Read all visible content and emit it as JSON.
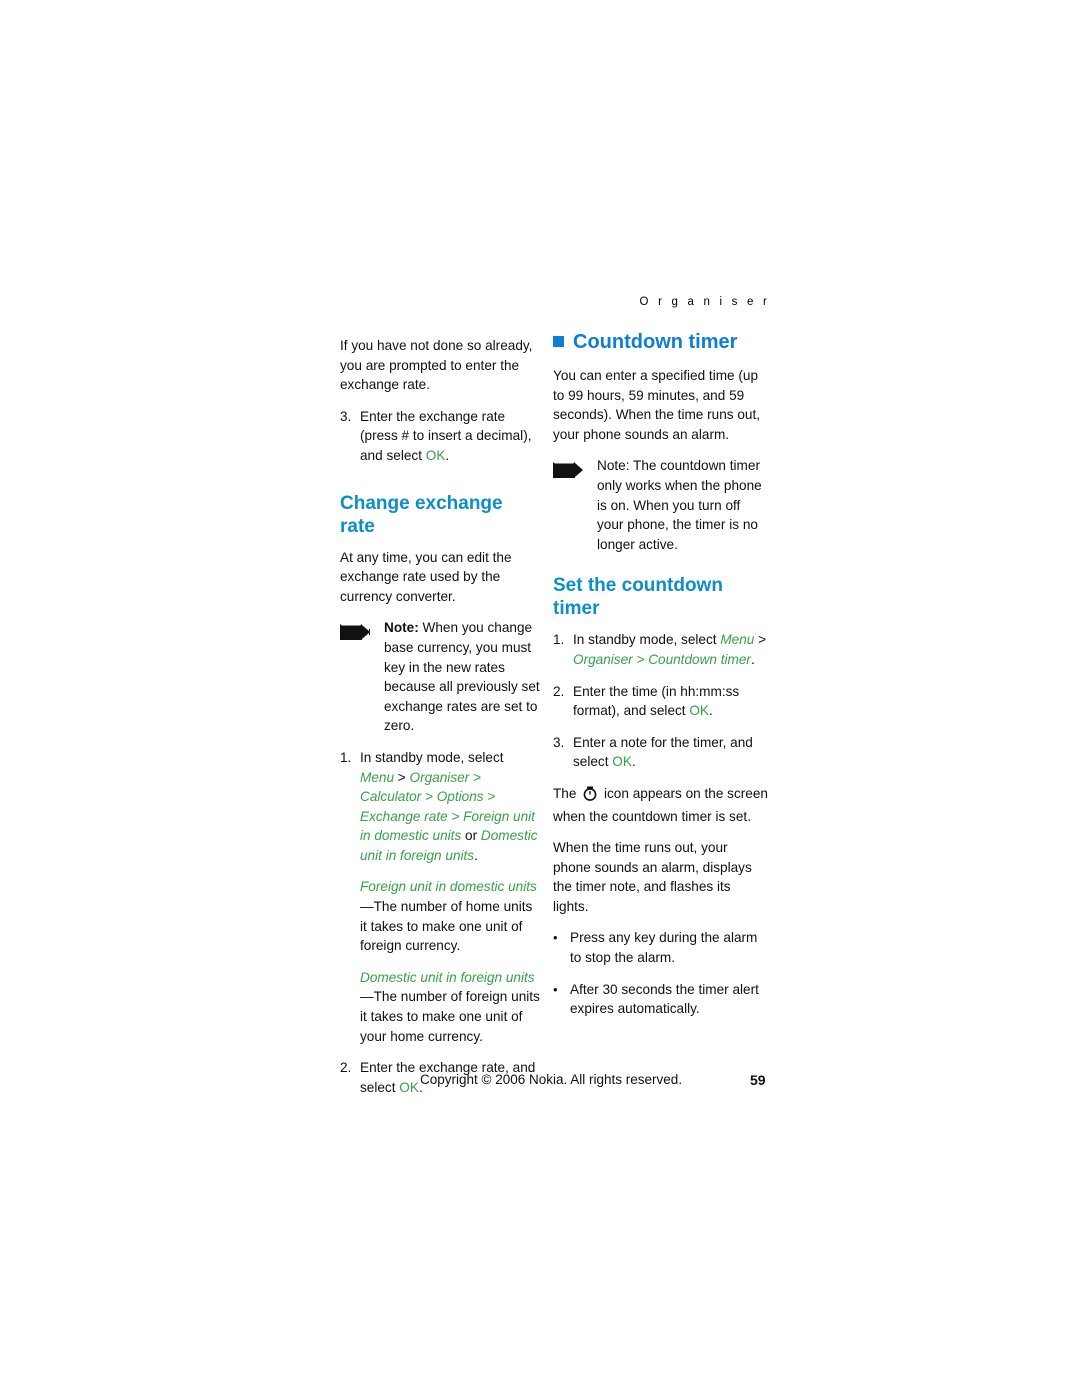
{
  "header": {
    "running_head": "O r g a n i s e r"
  },
  "left_column": {
    "para1": "If you have not done so already, you are prompted to enter the exchange rate.",
    "step3_num": "3.",
    "step3_pre": "Enter the exchange rate (press ",
    "step3_hash": "#",
    "step3_mid": " to insert a decimal), and select ",
    "step3_ok": "OK",
    "step3_end": ".",
    "heading_change_exchange_rate": "Change exchange rate",
    "para2": "At any time, you can edit the exchange rate used by the currency converter.",
    "note1_label": "Note:",
    "note1_text": " When you change base currency, you must key in the new rates because all previously set exchange rates are set to zero.",
    "step1_num": "1.",
    "step1_pre": "In standby mode, select ",
    "step1_menu": "Menu",
    "step1_gt1": " > ",
    "step1_organiser": "Organiser",
    "step1_gt2": " > ",
    "step1_calculator": "Calculator",
    "step1_gt3": " > ",
    "step1_options": "Options",
    "step1_gt4": " > ",
    "step1_exchange": "Exchange rate",
    "step1_gt5": " > ",
    "step1_foreign": "Foreign unit in domestic units",
    "step1_or": " or ",
    "step1_domestic": "Domestic unit in foreign units",
    "step1_period": ".",
    "def1_term": "Foreign unit in domestic units",
    "def1_dash": "—The",
    "def1_text": " number of home units it takes to make one unit of foreign currency.",
    "def2_term": "Domestic unit in foreign units",
    "def2_dash": "—The",
    "def2_text": " number of foreign units it takes to make one unit of your home currency.",
    "step2_num": "2.",
    "step2_pre": "Enter the exchange rate, and select ",
    "step2_ok": "OK",
    "step2_end": "."
  },
  "right_column": {
    "heading_countdown_timer": "Countdown timer",
    "para1": "You can enter a specified time (up to 99 hours, 59 minutes, and 59 seconds). When the time runs out, your phone sounds an alarm.",
    "note1_label": "Note:",
    "note1_text": " The countdown timer only works when the phone is on. When you turn off your phone, the timer is no longer active.",
    "heading_set_countdown": "Set the countdown timer",
    "step1_num": "1.",
    "step1_pre": "In standby mode, select ",
    "step1_menu": "Menu",
    "step1_gt1": " > ",
    "step1_organiser": "Organiser",
    "step1_gt2": " > ",
    "step1_countdown": "Countdown timer",
    "step1_end": ".",
    "step2_num": "2.",
    "step2_pre": "Enter the time (in hh:mm:ss format), and select ",
    "step2_ok": "OK",
    "step2_end": ".",
    "step3_num": "3.",
    "step3_pre": "Enter a note for the timer, and select ",
    "step3_ok": "OK",
    "step3_end": ".",
    "para2_pre": "The ",
    "para2_post": " icon appears on the screen when the countdown timer is set.",
    "para3": "When the time runs out, your phone sounds an alarm, displays the timer note, and flashes its lights.",
    "bullet1": "Press any key during the alarm to stop the alarm.",
    "bullet2": "After 30 seconds the timer alert expires automatically.",
    "bullet_glyph": "•"
  },
  "footer": {
    "copyright": "Copyright © 2006 Nokia. All rights reserved.",
    "page_number": "59"
  },
  "colors": {
    "heading_blue": "#0b8fc7",
    "link_green": "#37a04a"
  }
}
